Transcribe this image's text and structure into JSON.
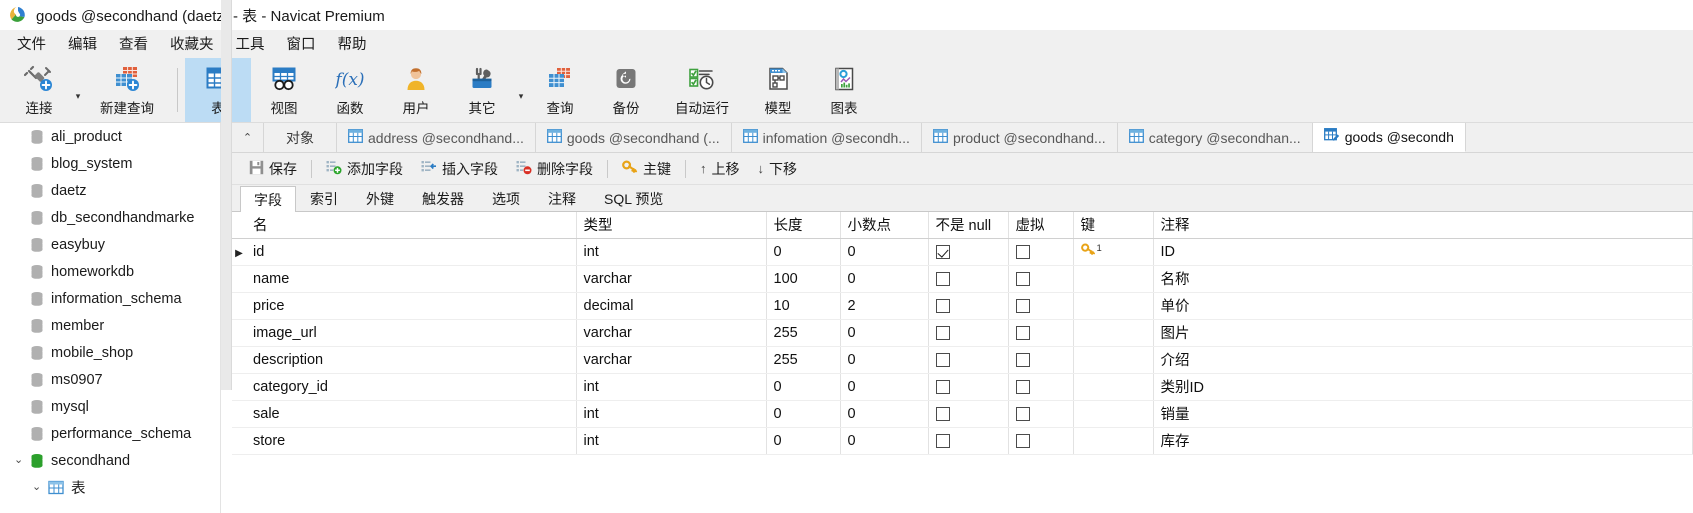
{
  "window": {
    "title": "goods @secondhand (daetz) - 表 - Navicat Premium",
    "logo_icon": "navicat-logo-icon"
  },
  "menubar": {
    "items": [
      {
        "label": "文件",
        "name": "menu-file"
      },
      {
        "label": "编辑",
        "name": "menu-edit"
      },
      {
        "label": "查看",
        "name": "menu-view"
      },
      {
        "label": "收藏夹",
        "name": "menu-favorites"
      },
      {
        "label": "工具",
        "name": "menu-tools"
      },
      {
        "label": "窗口",
        "name": "menu-window"
      },
      {
        "label": "帮助",
        "name": "menu-help"
      }
    ]
  },
  "ribbon": {
    "buttons": [
      {
        "label": "连接",
        "icon": "connection-icon",
        "name": "ribbon-connection",
        "active": false,
        "caret": true
      },
      {
        "label": "新建查询",
        "icon": "new-query-icon",
        "name": "ribbon-new-query",
        "active": false,
        "caret": false
      },
      {
        "label": "表",
        "icon": "table-icon",
        "name": "ribbon-table",
        "active": true,
        "caret": false
      },
      {
        "label": "视图",
        "icon": "view-icon",
        "name": "ribbon-view",
        "active": false,
        "caret": false
      },
      {
        "label": "函数",
        "icon": "function-fx-icon",
        "name": "ribbon-function",
        "active": false,
        "caret": false
      },
      {
        "label": "用户",
        "icon": "user-icon",
        "name": "ribbon-user",
        "active": false,
        "caret": false
      },
      {
        "label": "其它",
        "icon": "other-tools-icon",
        "name": "ribbon-other",
        "active": false,
        "caret": true
      },
      {
        "label": "查询",
        "icon": "query-icon",
        "name": "ribbon-query",
        "active": false,
        "caret": false
      },
      {
        "label": "备份",
        "icon": "backup-icon",
        "name": "ribbon-backup",
        "active": false,
        "caret": false
      },
      {
        "label": "自动运行",
        "icon": "automation-icon",
        "name": "ribbon-automation",
        "active": false,
        "caret": false
      },
      {
        "label": "模型",
        "icon": "model-icon",
        "name": "ribbon-model",
        "active": false,
        "caret": false
      },
      {
        "label": "图表",
        "icon": "chart-icon",
        "name": "ribbon-chart",
        "active": false,
        "caret": false
      }
    ]
  },
  "sidebar": {
    "items": [
      {
        "label": "ali_product",
        "level": 1,
        "icon": "database-icon",
        "expanded": null,
        "selected": false
      },
      {
        "label": "blog_system",
        "level": 1,
        "icon": "database-icon",
        "expanded": null,
        "selected": false
      },
      {
        "label": "daetz",
        "level": 1,
        "icon": "database-icon",
        "expanded": null,
        "selected": false
      },
      {
        "label": "db_secondhandmarke",
        "level": 1,
        "icon": "database-icon",
        "expanded": null,
        "selected": false
      },
      {
        "label": "easybuy",
        "level": 1,
        "icon": "database-icon",
        "expanded": null,
        "selected": false
      },
      {
        "label": "homeworkdb",
        "level": 1,
        "icon": "database-icon",
        "expanded": null,
        "selected": false
      },
      {
        "label": "information_schema",
        "level": 1,
        "icon": "database-icon",
        "expanded": null,
        "selected": false
      },
      {
        "label": "member",
        "level": 1,
        "icon": "database-icon",
        "expanded": null,
        "selected": false
      },
      {
        "label": "mobile_shop",
        "level": 1,
        "icon": "database-icon",
        "expanded": null,
        "selected": false
      },
      {
        "label": "ms0907",
        "level": 1,
        "icon": "database-icon",
        "expanded": null,
        "selected": false
      },
      {
        "label": "mysql",
        "level": 1,
        "icon": "database-icon",
        "expanded": null,
        "selected": false
      },
      {
        "label": "performance_schema",
        "level": 1,
        "icon": "database-icon",
        "expanded": null,
        "selected": false
      },
      {
        "label": "secondhand",
        "level": 1,
        "icon": "database-open-icon",
        "expanded": true,
        "selected": false
      },
      {
        "label": "表",
        "level": 2,
        "icon": "table-folder-icon",
        "expanded": true,
        "selected": false
      }
    ]
  },
  "tabstrip": {
    "collapse_icon": "chevron-up-icon",
    "tabs": [
      {
        "label": "对象",
        "icon": null,
        "name": "tab-objects",
        "active": false
      },
      {
        "label": "address @secondhand...",
        "icon": "table-tab-icon",
        "name": "tab-address",
        "active": false
      },
      {
        "label": "goods @secondhand (...",
        "icon": "table-tab-icon",
        "name": "tab-goods-data",
        "active": false
      },
      {
        "label": "infomation @secondh...",
        "icon": "table-tab-icon",
        "name": "tab-infomation",
        "active": false
      },
      {
        "label": "product @secondhand...",
        "icon": "table-tab-icon",
        "name": "tab-product",
        "active": false
      },
      {
        "label": "category @secondhan...",
        "icon": "table-tab-icon",
        "name": "tab-category",
        "active": false
      },
      {
        "label": "goods @secondh",
        "icon": "table-design-tab-icon",
        "name": "tab-goods-design",
        "active": true
      }
    ]
  },
  "designbar": {
    "buttons": [
      {
        "label": "保存",
        "icon": "save-icon",
        "name": "save-button"
      },
      {
        "label": "添加字段",
        "icon": "add-field-icon",
        "name": "add-field-button"
      },
      {
        "label": "插入字段",
        "icon": "insert-field-icon",
        "name": "insert-field-button"
      },
      {
        "label": "删除字段",
        "icon": "delete-field-icon",
        "name": "delete-field-button"
      },
      {
        "label": "主键",
        "icon": "primary-key-icon",
        "name": "primary-key-button"
      },
      {
        "label": "上移",
        "icon": "arrow-up-icon",
        "name": "move-up-button"
      },
      {
        "label": "下移",
        "icon": "arrow-down-icon",
        "name": "move-down-button"
      }
    ]
  },
  "subtabs": {
    "items": [
      {
        "label": "字段",
        "name": "subtab-fields",
        "active": true
      },
      {
        "label": "索引",
        "name": "subtab-indexes",
        "active": false
      },
      {
        "label": "外键",
        "name": "subtab-foreign-keys",
        "active": false
      },
      {
        "label": "触发器",
        "name": "subtab-triggers",
        "active": false
      },
      {
        "label": "选项",
        "name": "subtab-options",
        "active": false
      },
      {
        "label": "注释",
        "name": "subtab-comment",
        "active": false
      },
      {
        "label": "SQL 预览",
        "name": "subtab-sql-preview",
        "active": false
      }
    ]
  },
  "grid": {
    "columns": [
      "名",
      "类型",
      "长度",
      "小数点",
      "不是 null",
      "虚拟",
      "键",
      "注释"
    ],
    "rows": [
      {
        "name": "id",
        "type": "int",
        "length": "0",
        "decimals": "0",
        "not_null": true,
        "virtual": false,
        "key": "1",
        "comment": "ID",
        "current": true
      },
      {
        "name": "name",
        "type": "varchar",
        "length": "100",
        "decimals": "0",
        "not_null": false,
        "virtual": false,
        "key": null,
        "comment": "名称",
        "current": false
      },
      {
        "name": "price",
        "type": "decimal",
        "length": "10",
        "decimals": "2",
        "not_null": false,
        "virtual": false,
        "key": null,
        "comment": "单价",
        "current": false
      },
      {
        "name": "image_url",
        "type": "varchar",
        "length": "255",
        "decimals": "0",
        "not_null": false,
        "virtual": false,
        "key": null,
        "comment": "图片",
        "current": false
      },
      {
        "name": "description",
        "type": "varchar",
        "length": "255",
        "decimals": "0",
        "not_null": false,
        "virtual": false,
        "key": null,
        "comment": "介绍",
        "current": false
      },
      {
        "name": "category_id",
        "type": "int",
        "length": "0",
        "decimals": "0",
        "not_null": false,
        "virtual": false,
        "key": null,
        "comment": "类别ID",
        "current": false
      },
      {
        "name": "sale",
        "type": "int",
        "length": "0",
        "decimals": "0",
        "not_null": false,
        "virtual": false,
        "key": null,
        "comment": "销量",
        "current": false
      },
      {
        "name": "store",
        "type": "int",
        "length": "0",
        "decimals": "0",
        "not_null": false,
        "virtual": false,
        "key": null,
        "comment": "库存",
        "current": false
      }
    ]
  },
  "colors": {
    "accent_blue": "#2b7cc4",
    "ribbon_active": "#bcdcf4",
    "key_gold": "#e8a317",
    "db_green": "#2ca02c",
    "chrome_gray": "#f0f0f0"
  }
}
